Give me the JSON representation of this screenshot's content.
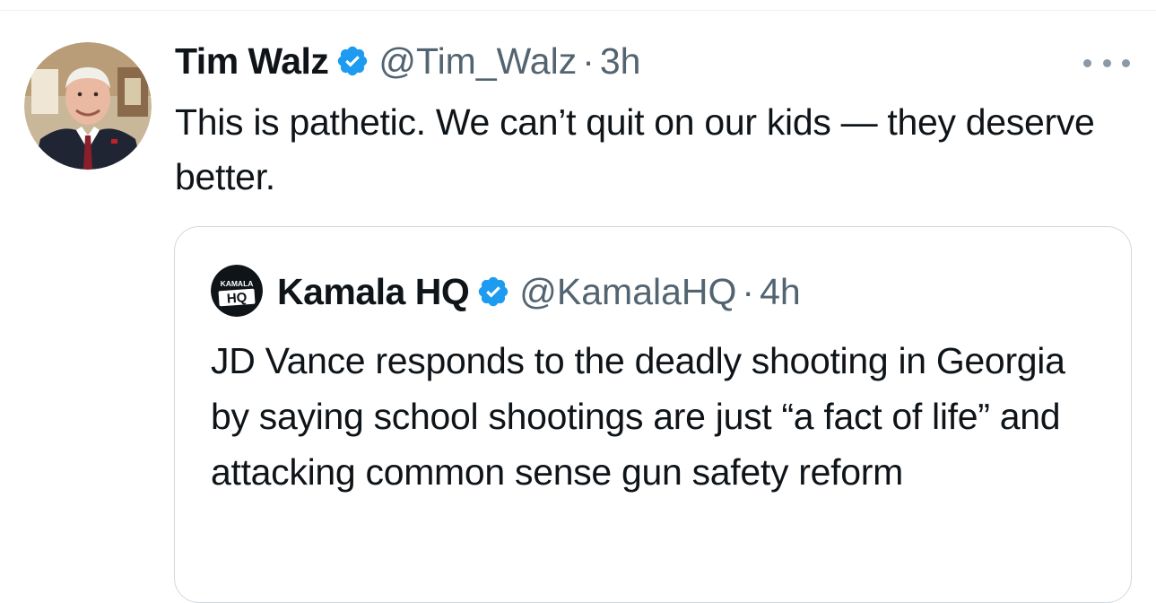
{
  "tweet": {
    "author_name": "Tim Walz",
    "handle": "@Tim_Walz",
    "separator": "·",
    "time": "3h",
    "text": "This is pathetic. We can’t quit on our kids — they deserve better.",
    "avatar_icon": "profile-photo-icon",
    "verified_icon": "verified-badge-icon",
    "more_icon": "more-options-icon"
  },
  "quote": {
    "author_name": "Kamala HQ",
    "handle": "@KamalaHQ",
    "separator": "·",
    "time": "4h",
    "text": "JD Vance responds to the deadly shooting in Georgia by saying school shootings are just “a fact of life” and attacking common sense gun safety reform",
    "avatar_logo_text": "KAMALA HQ",
    "verified_icon": "verified-badge-icon"
  },
  "colors": {
    "text": "#0f1419",
    "secondary": "#536471",
    "verified": "#1d9bf0",
    "border": "#cfd9de"
  }
}
